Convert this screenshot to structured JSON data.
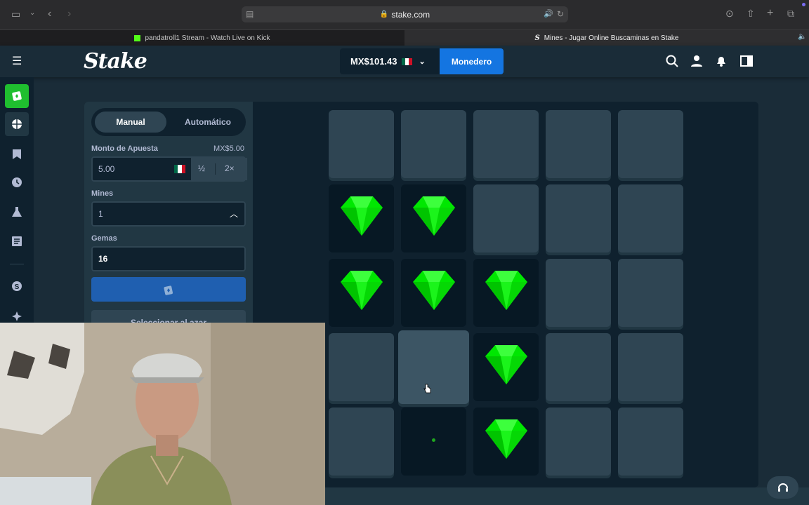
{
  "browser": {
    "url": "stake.com",
    "tabs": [
      {
        "label": "pandatroll1 Stream - Watch Live on Kick"
      },
      {
        "label": "Mines - Jugar Online Buscaminas en Stake"
      }
    ]
  },
  "header": {
    "logo": "Stake",
    "balance": "MX$101.43",
    "wallet_label": "Monedero"
  },
  "panel": {
    "mode_tabs": [
      "Manual",
      "Automático"
    ],
    "bet_label": "Monto de Apuesta",
    "bet_value_display": "MX$5.00",
    "bet_input": "5.00",
    "half_label": "½",
    "double_label": "2×",
    "mines_label": "Mines",
    "mines_value": "1",
    "gems_label": "Gemas",
    "gems_value": "16",
    "random_label": "Seleccionar al azar"
  },
  "board": {
    "rows": 5,
    "cols": 5,
    "states": [
      [
        "hidden",
        "hidden",
        "hidden",
        "hidden",
        "hidden"
      ],
      [
        "gem",
        "gem",
        "hidden",
        "hidden",
        "hidden"
      ],
      [
        "gem",
        "gem",
        "gem",
        "hidden",
        "hidden"
      ],
      [
        "hidden",
        "hover",
        "gem",
        "hidden",
        "hidden"
      ],
      [
        "hidden",
        "empty",
        "gem",
        "hidden",
        "hidden"
      ]
    ]
  },
  "colors": {
    "accent": "#1475e1",
    "gem": "#00e701",
    "tile": "#2f4553",
    "board": "#0f212e"
  }
}
